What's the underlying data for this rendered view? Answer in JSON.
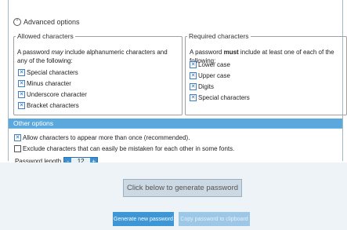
{
  "advanced": {
    "icon": "circle-up-icon",
    "label": "Advanced options"
  },
  "allowed": {
    "title": "Allowed characters",
    "description_pre": "A password ",
    "description_em": "may",
    "description_post": " include alphanumeric characters and any of the following:",
    "items": [
      {
        "label": "Special characters",
        "checked": true
      },
      {
        "label": "Minus character",
        "checked": true
      },
      {
        "label": "Underscore character",
        "checked": true
      },
      {
        "label": "Bracket characters",
        "checked": true
      }
    ]
  },
  "required": {
    "title": "Required characters",
    "description_pre": "A password ",
    "description_strong": "must",
    "description_post": " include at least one of each of the following:",
    "items": [
      {
        "label": "Lower case",
        "checked": true
      },
      {
        "label": "Upper case",
        "checked": true
      },
      {
        "label": "Digits",
        "checked": true
      },
      {
        "label": "Special characters",
        "checked": true
      }
    ]
  },
  "other": {
    "title": "Other options",
    "options": [
      {
        "label": "Allow characters to appear more than once (recommended).",
        "checked": true
      },
      {
        "label": "Exclude characters that can easily be mistaken for each other in some fonts.",
        "checked": false
      }
    ],
    "password_length_label": "Password length",
    "password_length": "12",
    "minus": "-",
    "plus": "+"
  },
  "generator": {
    "placeholder": "Click below to generate password",
    "generate_label": "Generate new password",
    "copy_label": "Copy password to clipboard"
  },
  "colors": {
    "accent": "#3d96d6",
    "bar": "#5aa8dd"
  }
}
